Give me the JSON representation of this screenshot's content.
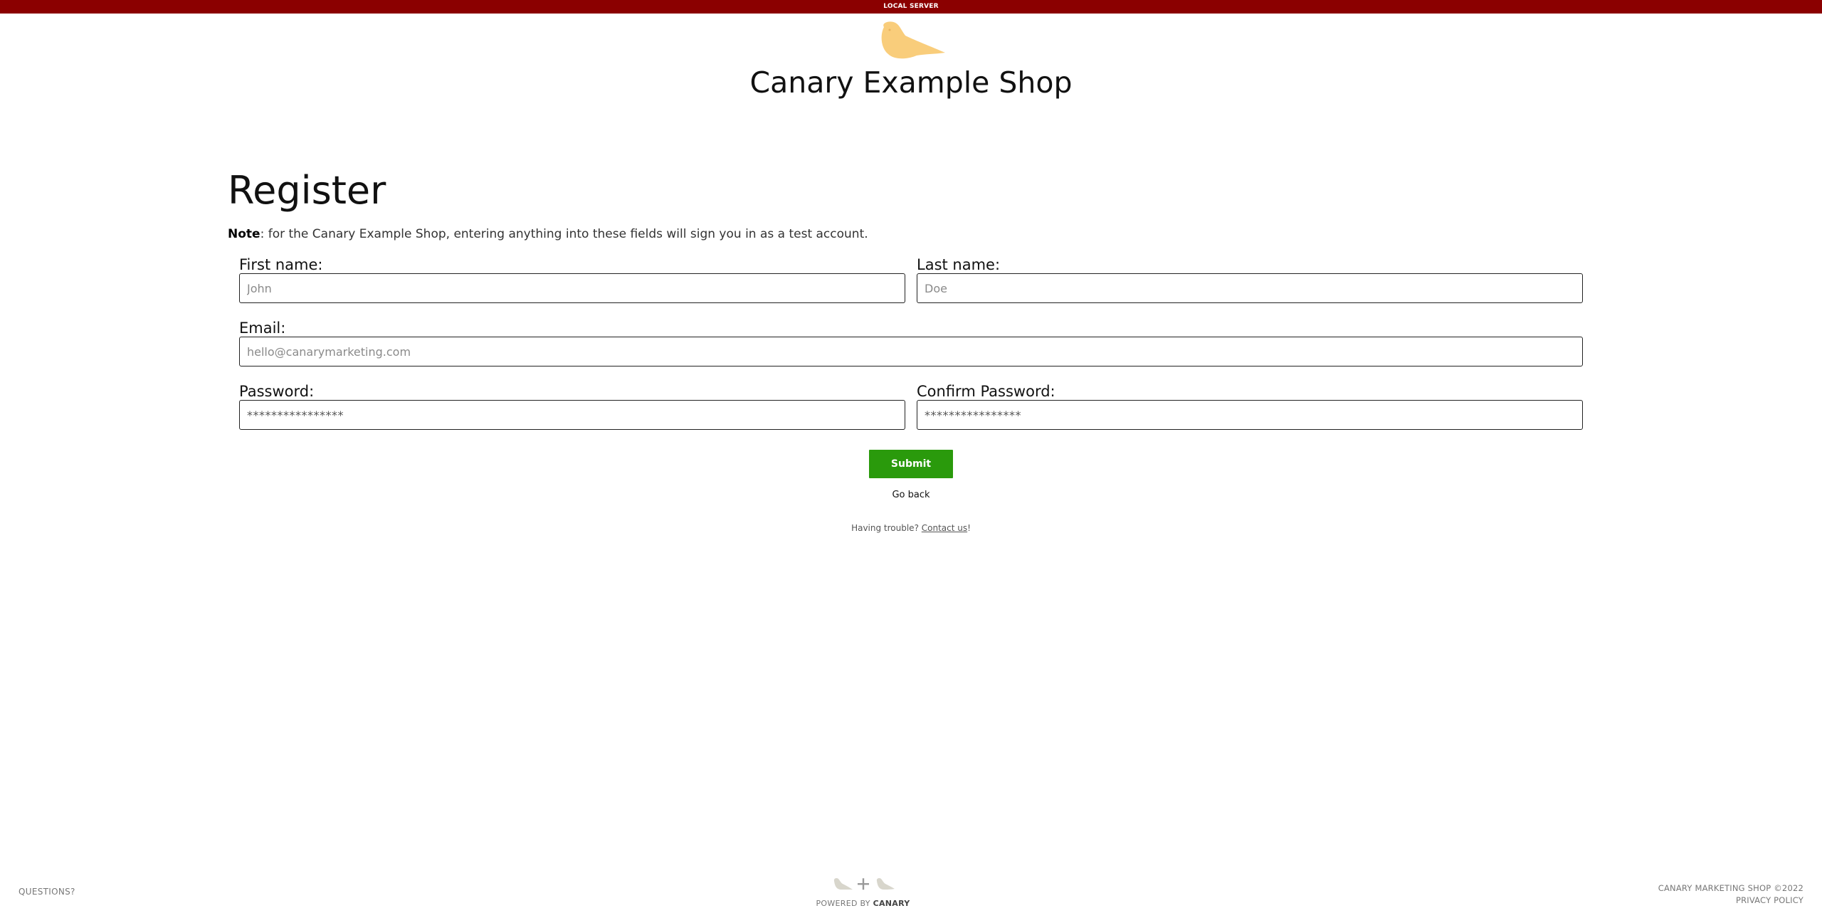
{
  "banner": {
    "text": "LOCAL SERVER"
  },
  "brand": {
    "logo_icon": "canary-bird-icon",
    "logo_color": "#f9cd7b",
    "title": "Canary Example Shop"
  },
  "page": {
    "heading": "Register",
    "note_label": "Note",
    "note_text": ": for the Canary Example Shop, entering anything into these fields will sign you in as a test account."
  },
  "form": {
    "first_name": {
      "label": "First name:",
      "placeholder": "John"
    },
    "last_name": {
      "label": "Last name:",
      "placeholder": "Doe"
    },
    "email": {
      "label": "Email:",
      "placeholder": "hello@canarymarketing.com"
    },
    "password": {
      "label": "Password:",
      "placeholder": "****************"
    },
    "confirm_password": {
      "label": "Confirm Password:",
      "placeholder": "****************"
    },
    "submit_label": "Submit",
    "go_back_label": "Go back",
    "trouble_text": "Having trouble? ",
    "contact_link": "Contact us",
    "trouble_suffix": "!"
  },
  "footer": {
    "questions": "QUESTIONS?",
    "powered_by": "POWERED BY ",
    "powered_brand": "CANARY",
    "copyright": "CANARY MARKETING SHOP ©2022",
    "privacy": "PRIVACY POLICY"
  },
  "colors": {
    "banner": "#8b0000",
    "submit": "#2a9a0c",
    "logo": "#f9cd7b"
  }
}
